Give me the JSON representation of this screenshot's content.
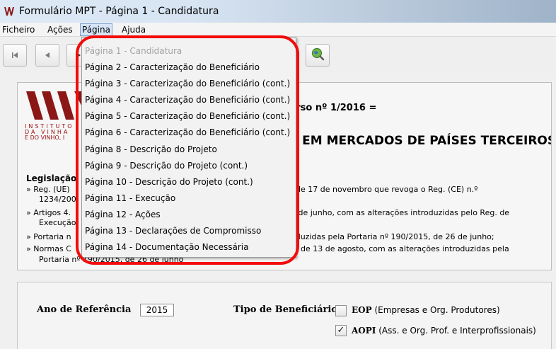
{
  "window": {
    "title": "Formulário MPT - Página 1 - Candidatura"
  },
  "menubar": {
    "items": [
      "Ficheiro",
      "Ações",
      "Página",
      "Ajuda"
    ],
    "open": "Página"
  },
  "toolbar": {
    "buttons": [
      "first-page-icon",
      "previous-page-icon",
      "next-page-icon",
      "search-globe-icon"
    ]
  },
  "page_menu": {
    "items": [
      {
        "label": "Página 1 - Candidatura",
        "enabled": false
      },
      {
        "label": "Página 2 - Caracterização do Beneficiário",
        "enabled": true
      },
      {
        "label": "Página 3 - Caracterização do Beneficiário (cont.)",
        "enabled": true
      },
      {
        "label": "Página 4 - Caracterização do Beneficiário (cont.)",
        "enabled": true
      },
      {
        "label": "Página 5 - Caracterização do Beneficiário (cont.)",
        "enabled": true
      },
      {
        "label": "Página 6 - Caracterização do Beneficiário (cont.)",
        "enabled": true
      },
      {
        "label": "Página 8 - Descrição do Projeto",
        "enabled": true
      },
      {
        "label": "Página 9 - Descrição do Projeto (cont.)",
        "enabled": true
      },
      {
        "label": "Página 10 - Descrição do Projeto (cont.)",
        "enabled": true
      },
      {
        "label": "Página 11 - Execução",
        "enabled": true
      },
      {
        "label": "Página 12 - Ações",
        "enabled": true
      },
      {
        "label": "Página 13 - Declarações de Compromisso",
        "enabled": true
      },
      {
        "label": "Página 14 - Documentação Necessária",
        "enabled": true
      }
    ]
  },
  "main": {
    "institute_lines": [
      "INSTITUTO",
      "DA VINHA",
      "E DO VINHO, I"
    ],
    "concurso": "urso nº 1/2016 =",
    "heading": "S EM MERCADOS DE PAÍSES TERCEIROS",
    "legislation": {
      "title": "Legislação",
      "left_fragments": [
        "» Reg. (UE)",
        "1234/200",
        "» Artigos 4.",
        "Execução",
        "» Portaria n",
        "» Normas C",
        "Portaria nº 190/2015, de 26 de junho"
      ],
      "right_fragments": [
        ", de 17 de novembro que revoga o Reg. (CE) n.º",
        "7 de junho, com as alterações introduzidas pelo Reg. de",
        "oduzidas pela Portaria nº 190/2015, de 26 de junho;",
        "3, de 13 de agosto, com as alterações introduzidas pela"
      ]
    }
  },
  "form": {
    "year_label": "Ano de Referência",
    "year_value": "2015",
    "type_label": "Tipo de Beneficiário",
    "options": [
      {
        "code": "EOP",
        "description": "(Empresas e Org. Produtores)",
        "checked": false
      },
      {
        "code": "AOPI",
        "description": "(Ass. e Org. Prof. e Interprofissionais)",
        "checked": true
      }
    ]
  },
  "colors": {
    "highlight": "#f20c0c",
    "logo": "#8b1717",
    "menu_open": "#d6e5f7"
  }
}
